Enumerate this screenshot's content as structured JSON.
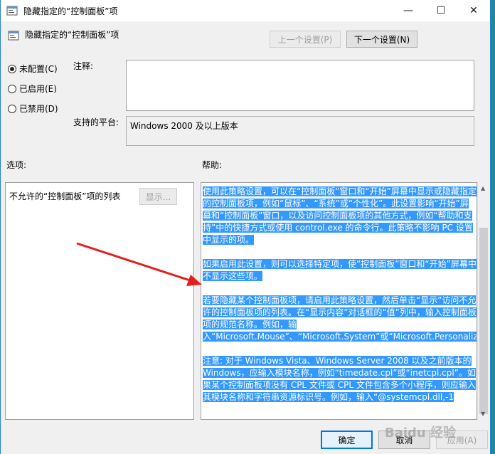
{
  "window": {
    "title": "隐藏指定的“控制面板”项"
  },
  "header": {
    "title": "隐藏指定的“控制面板”项"
  },
  "nav": {
    "prev_label": "上一个设置(P)",
    "next_label": "下一个设置(N)"
  },
  "state": {
    "selected": "not_configured",
    "options": [
      {
        "key": "not_configured",
        "label": "未配置(C)"
      },
      {
        "key": "enabled",
        "label": "已启用(E)"
      },
      {
        "key": "disabled",
        "label": "已禁用(D)"
      }
    ]
  },
  "comment": {
    "label": "注释:",
    "value": ""
  },
  "platform": {
    "label": "支持的平台:",
    "value": "Windows 2000 及以上版本"
  },
  "options_section": {
    "label": "选项:",
    "item_label": "不允许的“控制面板”项的列表",
    "show_button": "显示..."
  },
  "help_section": {
    "label": "帮助:",
    "paragraphs": [
      "使用此策略设置，可以在“控制面板”窗口和“开始”屏幕中显示或隐藏指定的控制面板项，例如“鼠标”、“系统”或“个性化”。此设置影响“开始”屏幕和“控制面板”窗口，以及访问控制面板项的其他方式，例如“帮助和支持”中的快捷方式或使用 control.exe 的命令行。此策略不影响 PC 设置中显示的项。",
      "如果启用此设置，则可以选择特定项，使“控制面板”窗口和“开始”屏幕中不显示这些项。",
      "若要隐藏某个控制面板项，请启用此策略设置，然后单击“显示”访问不允许的控制面板项的列表。在“显示内容”对话框的“值”列中，输入控制面板项的规范名称。例如，输入“Microsoft.Mouse”、“Microsoft.System”或“Microsoft.Personalization”。",
      "注意: 对于 Windows Vista、Windows Server 2008 以及之前版本的 Windows，应输入模块名称，例如“timedate.cpl”或“inetcpl.cpl”。如果某个控制面板项没有 CPL 文件或 CPL 文件包含多个小程序，则应输入其模块名称和字符串资源标识号。例如，输入“@systemcpl.dll,-1"
    ]
  },
  "buttons": {
    "ok": "确定",
    "cancel": "取消",
    "apply": "应用(A)"
  },
  "watermark": "Baidu 经验",
  "colors": {
    "selection": "#3399ff",
    "arrow": "#e02020",
    "accent": "#0078d7"
  }
}
